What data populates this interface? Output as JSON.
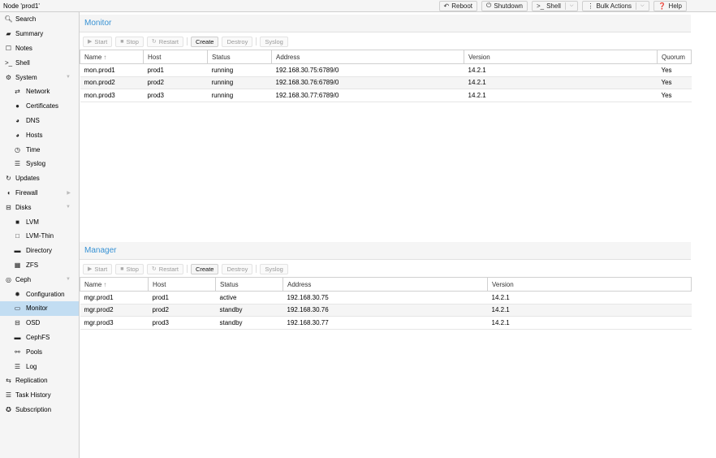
{
  "header": {
    "node_title": "Node 'prod1'",
    "buttons": [
      {
        "label": "Reboot",
        "icon": "undo-icon"
      },
      {
        "label": "Shutdown",
        "icon": "power-icon"
      },
      {
        "label": "Shell",
        "icon": "terminal-icon"
      },
      {
        "label": "Bulk Actions",
        "icon": "ellipsis-icon"
      },
      {
        "label": "Help",
        "icon": "question-icon"
      }
    ]
  },
  "sidebar": {
    "items": [
      {
        "label": "Search",
        "icon": "search-icon",
        "level": 0
      },
      {
        "label": "Summary",
        "icon": "book-icon",
        "level": 0
      },
      {
        "label": "Notes",
        "icon": "note-icon",
        "level": 0
      },
      {
        "label": "Shell",
        "icon": "terminal-icon",
        "level": 0
      },
      {
        "label": "System",
        "icon": "cogs-icon",
        "level": 0,
        "expandable": true
      },
      {
        "label": "Network",
        "icon": "exchange-icon",
        "level": 1
      },
      {
        "label": "Certificates",
        "icon": "certificate-icon",
        "level": 1
      },
      {
        "label": "DNS",
        "icon": "globe-icon",
        "level": 1
      },
      {
        "label": "Hosts",
        "icon": "globe-icon",
        "level": 1
      },
      {
        "label": "Time",
        "icon": "clock-icon",
        "level": 1
      },
      {
        "label": "Syslog",
        "icon": "list-icon",
        "level": 1
      },
      {
        "label": "Updates",
        "icon": "refresh-icon",
        "level": 0
      },
      {
        "label": "Firewall",
        "icon": "shield-icon",
        "level": 0,
        "expandable": true
      },
      {
        "label": "Disks",
        "icon": "hdd-icon",
        "level": 0,
        "expandable": true
      },
      {
        "label": "LVM",
        "icon": "square-icon",
        "level": 1
      },
      {
        "label": "LVM-Thin",
        "icon": "square-outline-icon",
        "level": 1
      },
      {
        "label": "Directory",
        "icon": "folder-icon",
        "level": 1
      },
      {
        "label": "ZFS",
        "icon": "th-large-icon",
        "level": 1
      },
      {
        "label": "Ceph",
        "icon": "ceph-icon",
        "level": 0,
        "expandable": true
      },
      {
        "label": "Configuration",
        "icon": "gear-icon",
        "level": 1
      },
      {
        "label": "Monitor",
        "icon": "desktop-icon",
        "level": 1,
        "selected": true
      },
      {
        "label": "OSD",
        "icon": "hdd-icon",
        "level": 1
      },
      {
        "label": "CephFS",
        "icon": "folder-icon",
        "level": 1
      },
      {
        "label": "Pools",
        "icon": "sitemap-icon",
        "level": 1
      },
      {
        "label": "Log",
        "icon": "list-icon",
        "level": 1
      },
      {
        "label": "Replication",
        "icon": "retweet-icon",
        "level": 0
      },
      {
        "label": "Task History",
        "icon": "list-icon",
        "level": 0
      },
      {
        "label": "Subscription",
        "icon": "support-icon",
        "level": 0
      }
    ]
  },
  "toolbar": {
    "start": "Start",
    "stop": "Stop",
    "restart": "Restart",
    "create": "Create",
    "destroy": "Destroy",
    "syslog": "Syslog"
  },
  "monitor": {
    "title": "Monitor",
    "columns": [
      "Name",
      "Host",
      "Status",
      "Address",
      "Version",
      "Quorum"
    ],
    "rows": [
      [
        "mon.prod1",
        "prod1",
        "running",
        "192.168.30.75:6789/0",
        "14.2.1",
        "Yes"
      ],
      [
        "mon.prod2",
        "prod2",
        "running",
        "192.168.30.76:6789/0",
        "14.2.1",
        "Yes"
      ],
      [
        "mon.prod3",
        "prod3",
        "running",
        "192.168.30.77:6789/0",
        "14.2.1",
        "Yes"
      ]
    ]
  },
  "manager": {
    "title": "Manager",
    "columns": [
      "Name",
      "Host",
      "Status",
      "Address",
      "Version"
    ],
    "rows": [
      [
        "mgr.prod1",
        "prod1",
        "active",
        "192.168.30.75",
        "14.2.1"
      ],
      [
        "mgr.prod2",
        "prod2",
        "standby",
        "192.168.30.76",
        "14.2.1"
      ],
      [
        "mgr.prod3",
        "prod3",
        "standby",
        "192.168.30.77",
        "14.2.1"
      ]
    ]
  },
  "colors": {
    "accent": "#3892d4",
    "selected": "#c2ddf2",
    "background": "#f5f5f5"
  }
}
